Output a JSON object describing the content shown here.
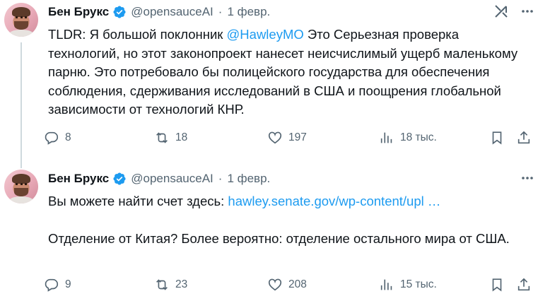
{
  "tweets": [
    {
      "author": {
        "name": "Бен Брукс",
        "handle": "@opensauceAI",
        "date": "1 февр."
      },
      "text": {
        "prefix": "TLDR: Я большой поклонник ",
        "mention": "@HawleyMO",
        "body": " Это Серьезная проверка технологий, но этот законопроект нанесет неисчислимый ущерб маленькому парню. Это потребовало бы полицейского государства для обеспечения соблюдения, сдерживания исследований в США и поощрения глобальной зависимости от технологий КНР."
      },
      "stats": {
        "replies": "8",
        "reposts": "18",
        "likes": "197",
        "views": "18 тыс."
      }
    },
    {
      "author": {
        "name": "Бен Брукс",
        "handle": "@opensauceAI",
        "date": "1 февр."
      },
      "text": {
        "line1": "Вы можете найти счет здесь: ",
        "link": "hawley.senate.gov/wp-content/upl …",
        "line2": "Отделение от Китая? Более вероятно: отделение остального мира от США."
      },
      "stats": {
        "replies": "9",
        "reposts": "23",
        "likes": "208",
        "views": "15 тыс."
      }
    }
  ],
  "colors": {
    "link": "#1d9bf0",
    "secondary_text": "#536471",
    "verified": "#1d9bf0",
    "thread_line": "#cfd9de"
  },
  "icons": [
    "verified-badge-icon",
    "grok-icon",
    "more-icon",
    "reply-icon",
    "repost-icon",
    "like-icon",
    "views-icon",
    "bookmark-icon",
    "share-icon"
  ]
}
